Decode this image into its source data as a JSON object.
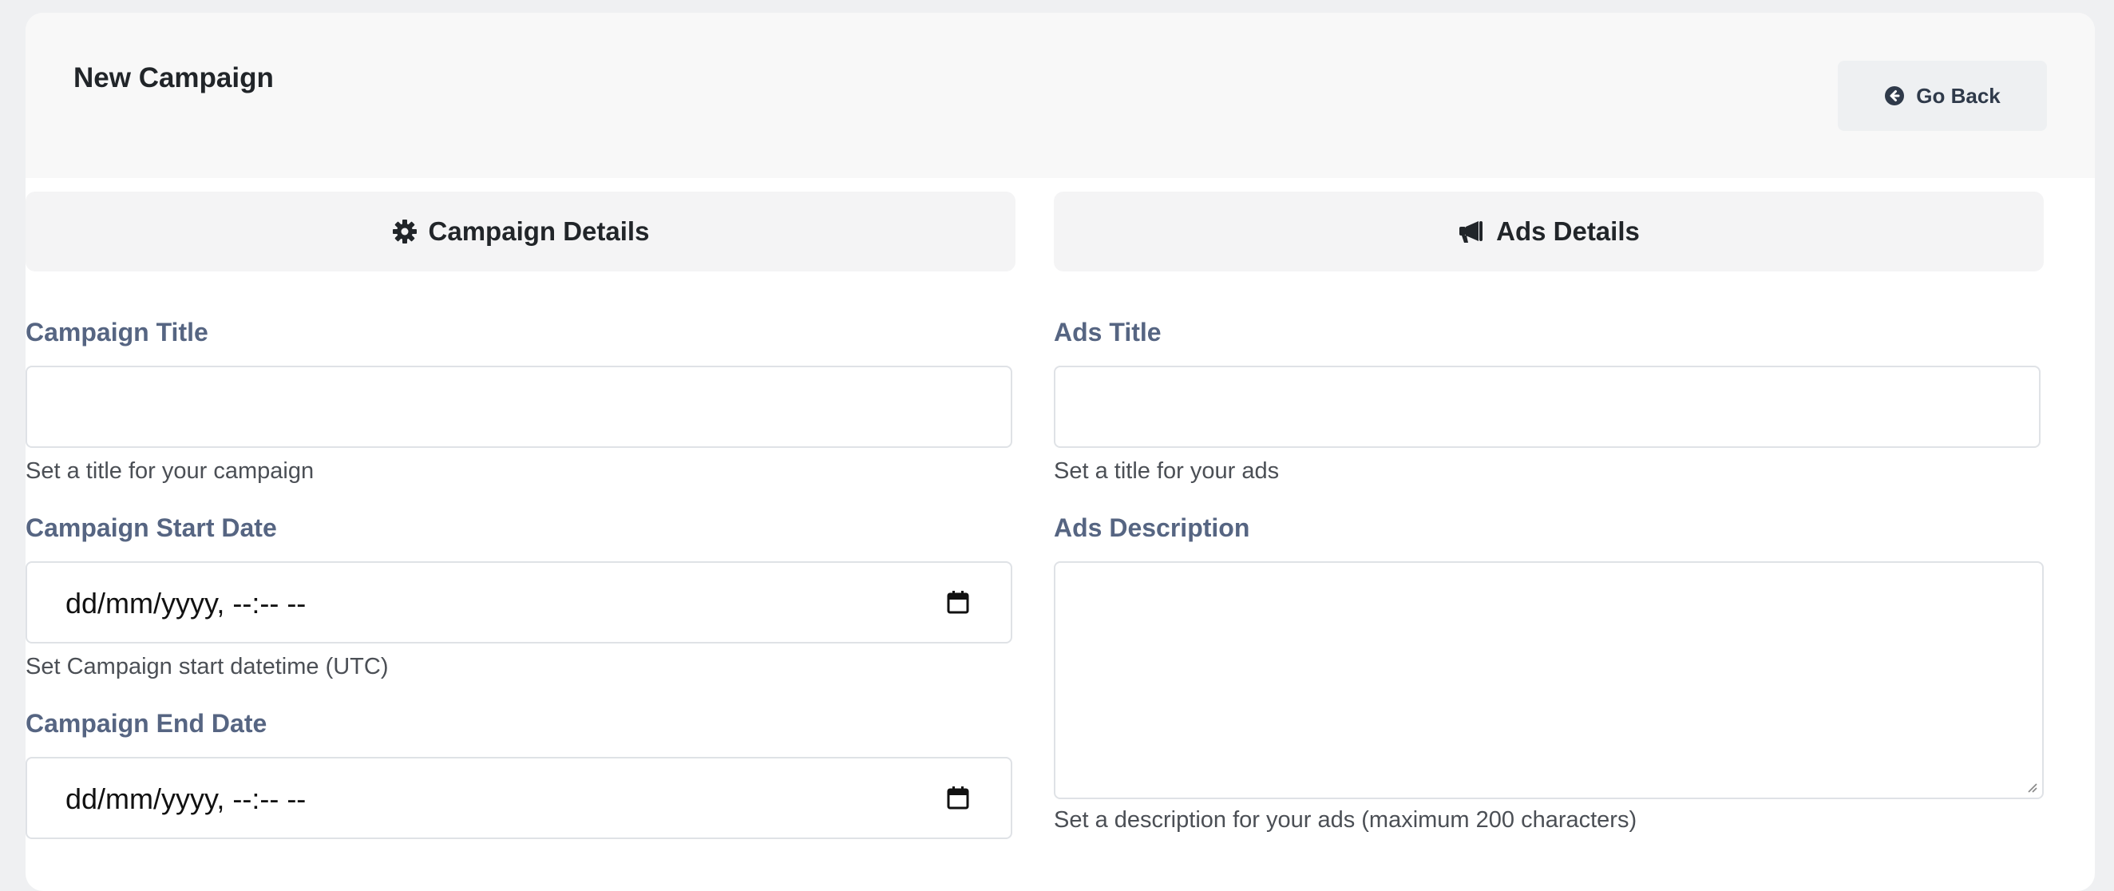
{
  "header": {
    "title": "New Campaign",
    "go_back_label": "Go Back",
    "go_back_icon": "arrow-circle-left-icon"
  },
  "campaign": {
    "section_title": "Campaign Details",
    "section_icon": "gear-icon",
    "title_label": "Campaign Title",
    "title_value": "",
    "title_help": "Set a title for your campaign",
    "start_label": "Campaign Start Date",
    "start_placeholder": "dd/mm/yyyy, --:-- --",
    "start_help": "Set Campaign start datetime (UTC)",
    "end_label": "Campaign End Date",
    "end_placeholder": "dd/mm/yyyy, --:-- --",
    "calendar_icon": "calendar-icon"
  },
  "ads": {
    "section_title": "Ads Details",
    "section_icon": "megaphone-icon",
    "title_label": "Ads Title",
    "title_value": "",
    "title_help": "Set a title for your ads",
    "description_label": "Ads Description",
    "description_value": "",
    "description_help": "Set a description for your ads (maximum 200 characters)"
  },
  "colors": {
    "label": "#566582",
    "header_bg": "#f8f8f8",
    "section_bg": "#f4f4f5",
    "border": "#dfe2e6"
  }
}
